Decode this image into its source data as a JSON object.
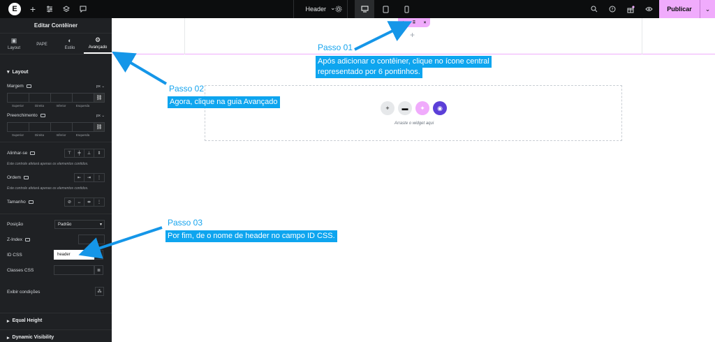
{
  "topbar": {
    "logo": "E",
    "add_icon": "+",
    "page_title": "Header",
    "chevron": "⌄",
    "publish_label": "Publicar",
    "publish_arrow": "⌄"
  },
  "panel": {
    "title": "Editar Contêiner",
    "tabs": [
      {
        "label": "Layout",
        "icon": "▣"
      },
      {
        "label": "PAPE",
        "icon": ""
      },
      {
        "label": "Estilo",
        "icon": "◐"
      },
      {
        "label": "Avançado",
        "icon": "⚙"
      }
    ],
    "section_layout": "Layout",
    "margin": {
      "label": "Margem",
      "unit": "px ⌄",
      "sides": [
        "Superior",
        "Direita",
        "Inferior",
        "Esquerda"
      ]
    },
    "padding": {
      "label": "Preenchimento",
      "unit": "px ⌄",
      "sides": [
        "Superior",
        "Direita",
        "Inferior",
        "Esquerda"
      ]
    },
    "align_self": {
      "label": "Alinhar-se",
      "note": "Este controle afetará apenas os elementos contidos."
    },
    "order": {
      "label": "Ordem",
      "note": "Este controle afetará apenas os elementos contidos."
    },
    "size": {
      "label": "Tamanho"
    },
    "position": {
      "label": "Posição",
      "value": "Padrão"
    },
    "z_index": {
      "label": "Z-Index"
    },
    "css_id": {
      "label": "ID CSS",
      "value": "header"
    },
    "css_classes": {
      "label": "Classes CSS"
    },
    "display_conditions": {
      "label": "Exibir condições"
    },
    "equal_height": "Equal Height",
    "dynamic_visibility": "Dynamic Visibility"
  },
  "canvas": {
    "dropzone_text": "Arraste o widget aqui",
    "plus": "+",
    "handle": {
      "add": "+",
      "move": "⠿",
      "close": "×"
    }
  },
  "annotations": {
    "step1_title": "Passo 01",
    "step1_line1": "Após adicionar o contêiner, clique no ícone central",
    "step1_line2": "representado por 6 pontinhos.",
    "step2_title": "Passo 02",
    "step2_text": "Agora, clique na guia Avançado",
    "step3_title": "Passo 03",
    "step3_text": "Por fim, de o nome de header no campo ID CSS."
  },
  "colors": {
    "accent": "#f0abfc",
    "annotation": "#0ea5ef",
    "panel_bg": "#1f2124"
  }
}
